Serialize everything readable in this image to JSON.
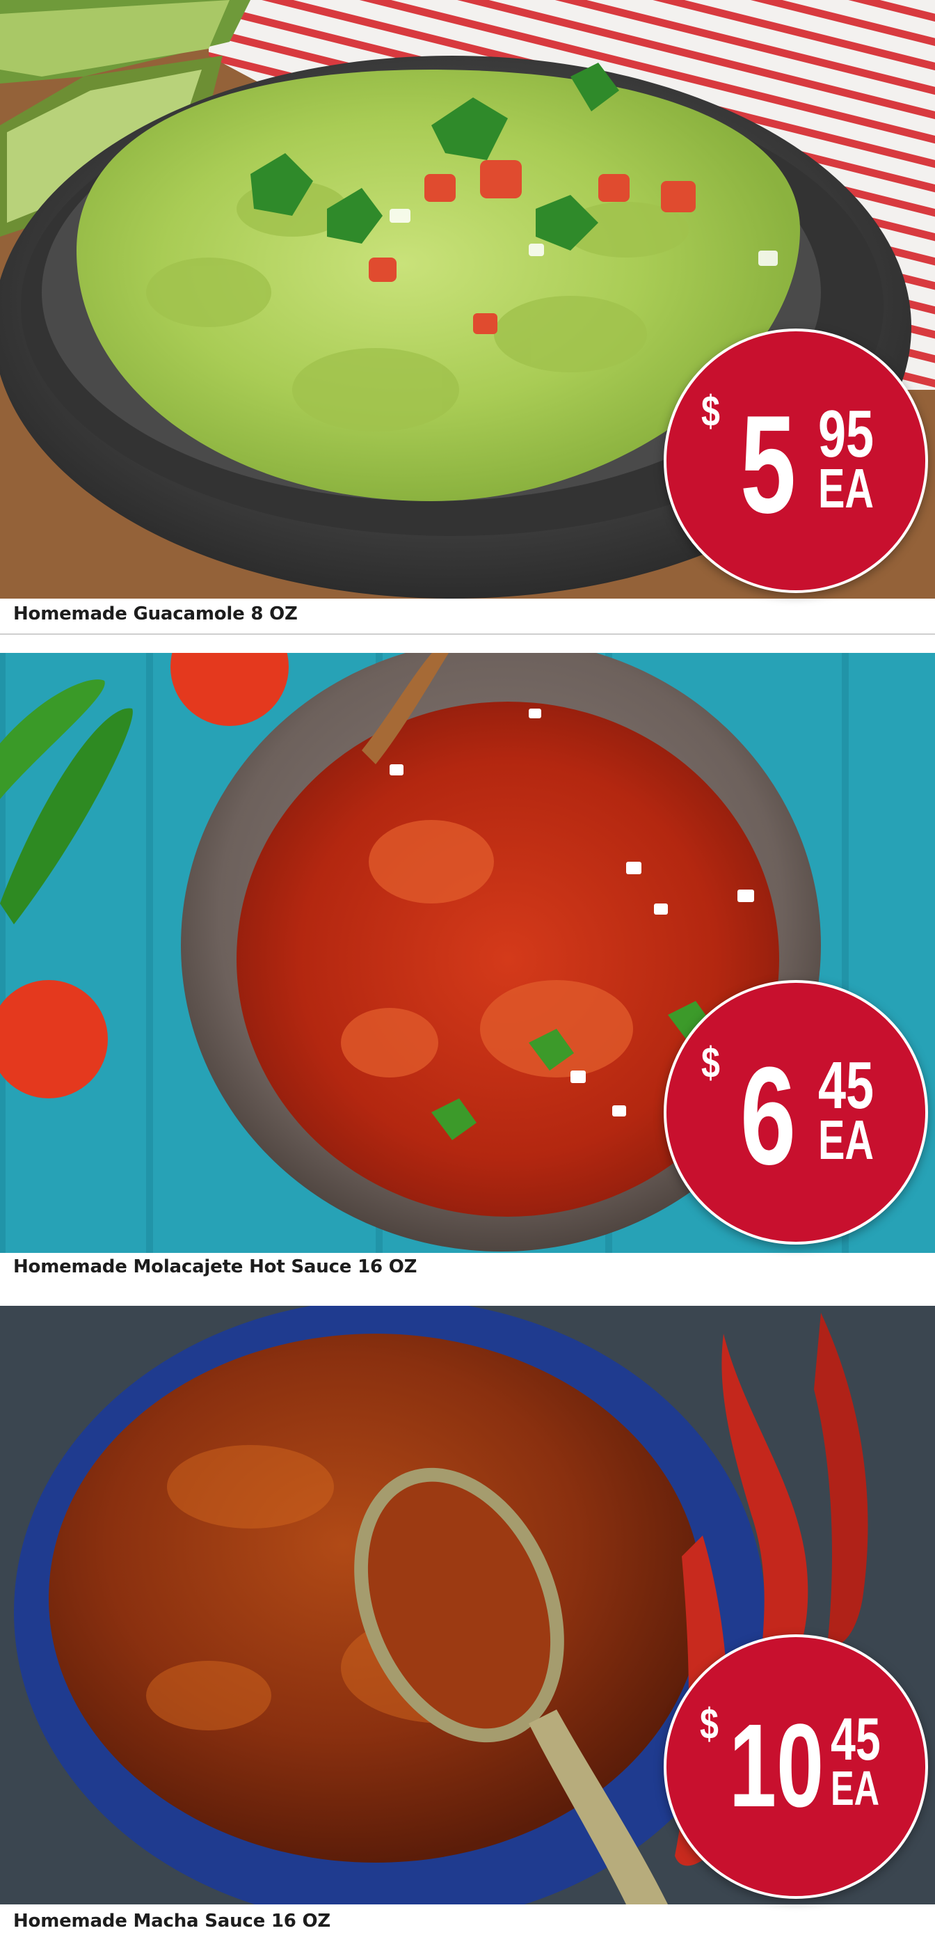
{
  "products": [
    {
      "name": "Homemade Guacamole 8 OZ",
      "image": "guacamole-in-molcajete",
      "price": {
        "currency": "$",
        "whole": "5",
        "cents": "95",
        "unit": "EA"
      }
    },
    {
      "name": "Homemade Molacajete Hot Sauce 16 OZ",
      "image": "red-salsa-in-molcajete",
      "price": {
        "currency": "$",
        "whole": "6",
        "cents": "45",
        "unit": "EA"
      }
    },
    {
      "name": "Homemade Macha Sauce 16 OZ",
      "image": "macha-sauce-in-blue-bowl",
      "price": {
        "currency": "$",
        "whole": "10",
        "cents": "45",
        "unit": "EA"
      }
    }
  ],
  "colors": {
    "badge_red": "#c8102e",
    "badge_text": "#ffffff",
    "caption_text": "#1d1d1d"
  }
}
